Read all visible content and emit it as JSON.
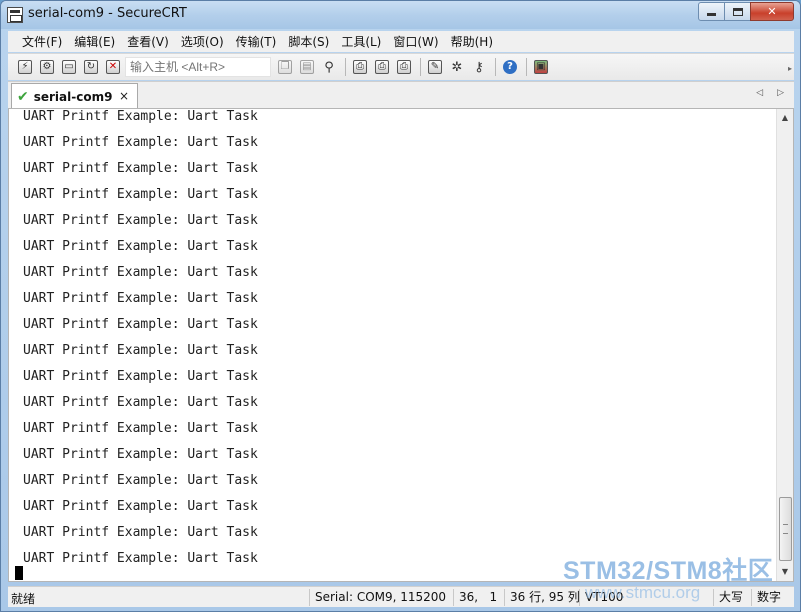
{
  "window": {
    "title": "serial-com9 - SecureCRT",
    "minimize_icon": "minimize-icon",
    "maximize_icon": "maximize-icon",
    "close_label": "✕"
  },
  "menu": [
    "文件(F)",
    "编辑(E)",
    "查看(V)",
    "选项(O)",
    "传输(T)",
    "脚本(S)",
    "工具(L)",
    "窗口(W)",
    "帮助(H)"
  ],
  "toolbar": {
    "host_input_placeholder": "输入主机 <Alt+R>"
  },
  "tab": {
    "label": "serial-com9",
    "close_label": "×",
    "left_arrow": "◁",
    "right_arrow": "▷"
  },
  "terminal": {
    "lines": [
      "UART Printf Example: Uart Task",
      "UART Printf Example: Uart Task",
      "UART Printf Example: Uart Task",
      "UART Printf Example: Uart Task",
      "UART Printf Example: Uart Task",
      "UART Printf Example: Uart Task",
      "UART Printf Example: Uart Task",
      "UART Printf Example: Uart Task",
      "UART Printf Example: Uart Task",
      "UART Printf Example: Uart Task",
      "UART Printf Example: Uart Task",
      "UART Printf Example: Uart Task",
      "UART Printf Example: Uart Task",
      "UART Printf Example: Uart Task",
      "UART Printf Example: Uart Task",
      "UART Printf Example: Uart Task",
      "UART Printf Example: Uart Task",
      "UART Printf Example: Uart Task"
    ]
  },
  "statusbar": {
    "ready": "就绪",
    "connection": "Serial: COM9, 115200",
    "cursor_pos": "36,   1",
    "size": "36 行, 95 列",
    "emulation": "VT100",
    "caps": "大写",
    "numlock": "数字"
  },
  "watermark": {
    "brand": "STM32/STM8社区",
    "url": "www.stmcu.org"
  }
}
